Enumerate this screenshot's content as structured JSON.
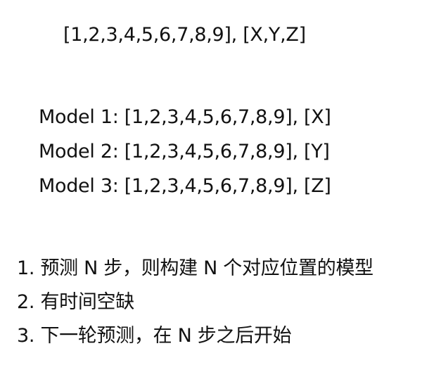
{
  "header_line": "[1,2,3,4,5,6,7,8,9], [X,Y,Z]",
  "models": [
    "Model 1: [1,2,3,4,5,6,7,8,9], [X]",
    "Model 2: [1,2,3,4,5,6,7,8,9], [Y]",
    "Model 3: [1,2,3,4,5,6,7,8,9], [Z]"
  ],
  "notes": [
    "1. 预测 N 步，则构建 N 个对应位置的模型",
    "2. 有时间空缺",
    "3. 下一轮预测，在 N 步之后开始"
  ]
}
